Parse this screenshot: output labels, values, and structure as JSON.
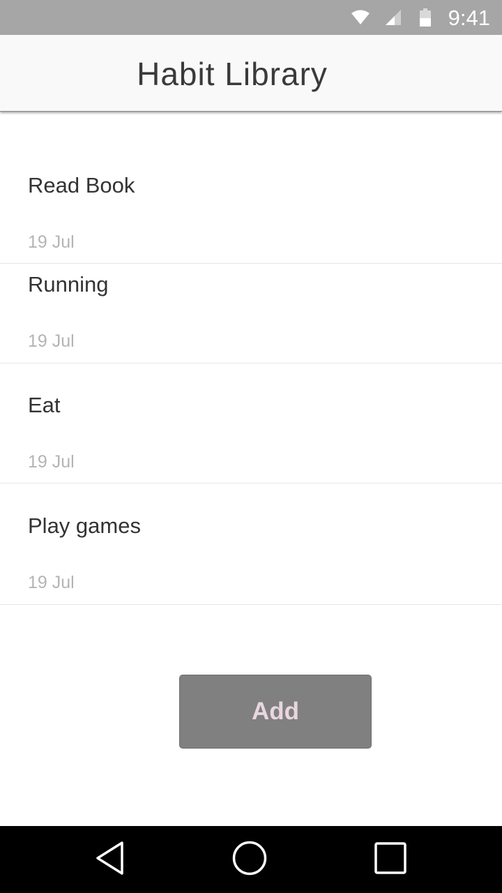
{
  "status_bar": {
    "time": "9:41",
    "icons": [
      "wifi-icon",
      "signal-icon",
      "battery-icon"
    ],
    "background": "#a6a6a6"
  },
  "app_bar": {
    "title": "Habit Library"
  },
  "habits": [
    {
      "name": "Read Book",
      "date": "19 Jul"
    },
    {
      "name": "Running",
      "date": "19 Jul"
    },
    {
      "name": "Eat",
      "date": "19 Jul"
    },
    {
      "name": "Play games",
      "date": "19 Jul"
    }
  ],
  "add_button": {
    "label": "Add",
    "background": "#808080",
    "text_color": "#e9d6de"
  },
  "nav_bar": {
    "icons": [
      "back-icon",
      "home-icon",
      "recents-icon"
    ]
  }
}
